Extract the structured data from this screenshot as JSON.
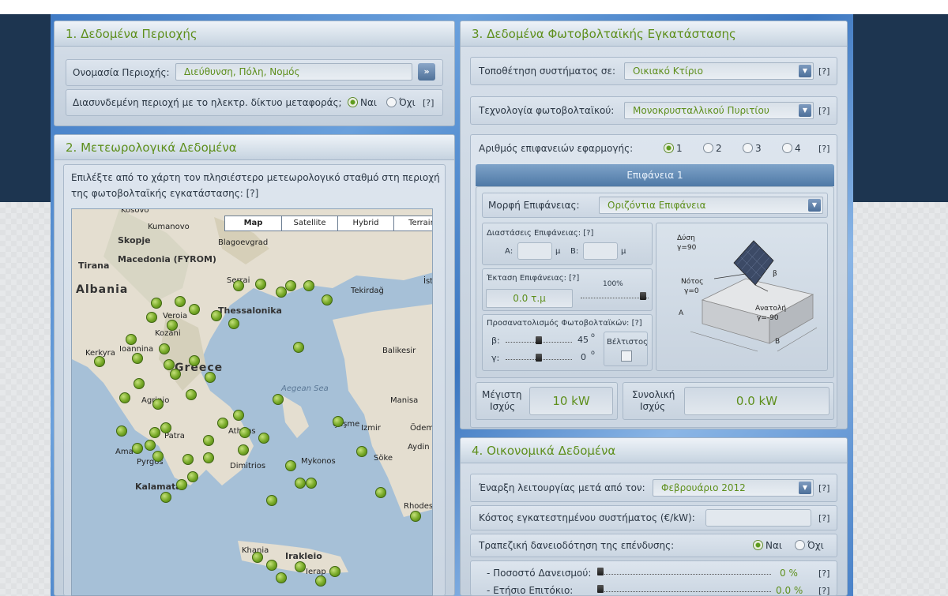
{
  "panel1": {
    "num": "1.",
    "title": "Δεδομένα Περιοχής",
    "area_label": "Ονομασία Περιοχής:",
    "area_placeholder": "Διεύθυνση, Πόλη, Νομός",
    "grid_label": "Διασυνδεμένη περιοχή με το ηλεκτρ. δίκτυο μεταφοράς;",
    "yes": "Ναι",
    "no": "Όχι",
    "help": "[?]"
  },
  "panel2": {
    "num": "2.",
    "title": "Μετεωρολογικά Δεδομένα",
    "instruction_line1": "Επιλέξτε από το χάρτη τον πλησιέστερο μετεωρολογικό σταθμό στη περιοχή",
    "instruction_line2": "της φωτοβολταϊκής εγκατάστασης: [?]",
    "map_tabs": [
      "Map",
      "Satellite",
      "Hybrid",
      "Terrain"
    ],
    "map_labels": {
      "kosovo": "Kosovo",
      "kumanovo": "Kumanovo",
      "blagoevgrad": "Blagoevgrad",
      "skopje": "Skopje",
      "macedonia": "Macedonia (FYROM)",
      "tirana": "Tirana",
      "albania": "Albania",
      "serrai": "Serrai",
      "tekirdag": "Tekirdağ",
      "ist": "İst",
      "thessalonika": "Thessalonika",
      "veroia": "Veroia",
      "kozani": "Kozani",
      "kerkyra": "Kerkyra",
      "ioannina": "Ioannina",
      "balikesir": "Balikesir",
      "greece": "Greece",
      "aegean": "Aegean Sea",
      "agrinio": "Agrinio",
      "manisa": "Manisa",
      "cesme": "Çeşme",
      "izmir": "Izmir",
      "odemi": "Ödemi",
      "patra": "Patra",
      "athens": "Athens",
      "aydin": "Aydin",
      "ama": "Ama",
      "pyrgos": "Pyrgos",
      "mykonos": "Mykonos",
      "dimitrios": "Dimitrios",
      "soke": "Söke",
      "kalamata": "Kalamata",
      "rhodes": "Rhodes",
      "khania": "Khania",
      "irakleio": "Irakleio",
      "ierap": "Ierap"
    }
  },
  "panel3": {
    "num": "3.",
    "title": "Δεδομένα Φωτοβολταϊκής Εγκατάστασης",
    "placement_label": "Τοποθέτηση συστήματος σε:",
    "placement_value": "Οικιακό Κτίριο",
    "tech_label": "Τεχνολογία φωτοβολταϊκού:",
    "tech_value": "Μονοκρυσταλλικού Πυριτίου",
    "surfaces_label": "Αριθμός επιφανειών εφαρμογής:",
    "surface_options": [
      "1",
      "2",
      "3",
      "4"
    ],
    "surface_tab": "Επιφάνεια 1",
    "shape_label": "Μορφή Επιφάνειας:",
    "shape_value": "Οριζόντια Επιφάνεια",
    "dims_label": "Διαστάσεις Επιφάνειας: [?]",
    "dim_a": "Α:",
    "dim_b": "Β:",
    "unit_m": "μ",
    "extent_label": "Έκταση Επιφάνειας: [?]",
    "extent_value": "0.0 τ.μ",
    "extent_percent": "100%",
    "orientation_label": "Προσανατολισμός Φωτοβολταϊκών: [?]",
    "beta_label": "β:",
    "beta_value": "45",
    "gamma_label": "γ:",
    "gamma_value": "0",
    "degree": "ο",
    "optimal_label": "Βέλτιστος",
    "diagram": {
      "west": "Δύση",
      "west_g": "γ=90",
      "south": "Νότος",
      "south_g": "γ=0",
      "east": "Ανατολή",
      "east_g": "γ=-90",
      "a": "Α",
      "b": "Β",
      "beta": "β"
    },
    "max_power_label_1": "Μέγιστη",
    "max_power_label_2": "Ισχύς",
    "max_power_value": "10 kW",
    "total_power_label_1": "Συνολική",
    "total_power_label_2": "Ισχύς",
    "total_power_value": "0.0 kW"
  },
  "panel4": {
    "num": "4.",
    "title": "Οικονομικά Δεδομένα",
    "start_label": "Έναρξη λειτουργίας μετά από τον:",
    "start_value": "Φεβρουάριο 2012",
    "cost_label": "Κόστος εγκατεστημένου συστήματος (€/kW):",
    "loan_label": "Τραπεζική δανειοδότηση της επένδυσης:",
    "yes": "Ναι",
    "no": "Όχι",
    "loan_pct_label": "- Ποσοστό Δανεισμού:",
    "loan_pct_value": "0 %",
    "interest_label": "- Ετήσιο Επιτόκιο:",
    "interest_value": "0.0 %"
  },
  "help": "[?]",
  "colors": {
    "accent_green": "#5e8f1c",
    "panel_bg": "#c9d4e0",
    "page_dark": "#1d3550"
  }
}
